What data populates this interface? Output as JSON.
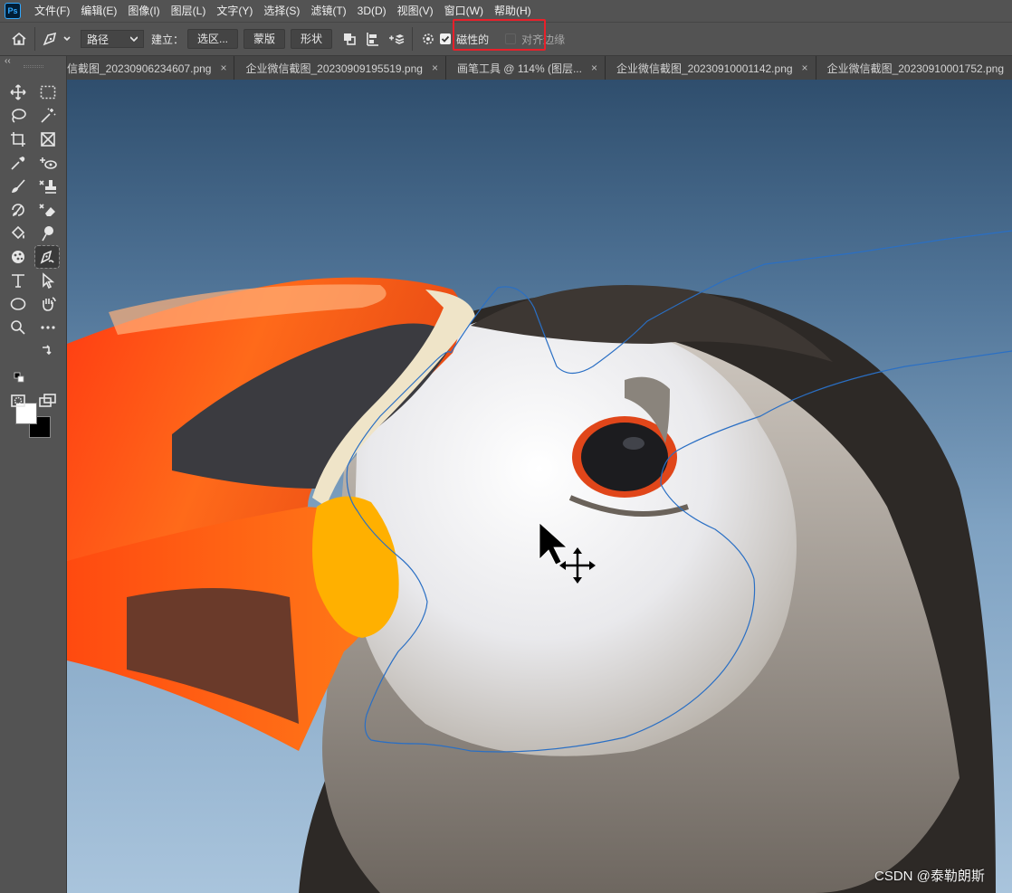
{
  "menubar": {
    "app_logo": "Ps",
    "items": [
      "文件(F)",
      "编辑(E)",
      "图像(I)",
      "图层(L)",
      "文字(Y)",
      "选择(S)",
      "滤镜(T)",
      "3D(D)",
      "视图(V)",
      "窗口(W)",
      "帮助(H)"
    ]
  },
  "options": {
    "mode_value": "路径",
    "make_label": "建立：",
    "selection_button": "选区...",
    "mask_button": "蒙版",
    "shape_button": "形状",
    "magnetic_label": "磁性的",
    "magnetic_checked": true,
    "align_edges_label": "对齐边缘",
    "align_edges_checked": false,
    "highlight_color": "#e8202a"
  },
  "tabs": [
    {
      "label": "信截图_20230906234607.png",
      "close": "×"
    },
    {
      "label": "企业微信截图_20230909195519.png",
      "close": "×"
    },
    {
      "label": "画笔工具 @ 114% (图层...",
      "close": "×"
    },
    {
      "label": "企业微信截图_20230910001142.png",
      "close": "×"
    },
    {
      "label": "企业微信截图_20230910001752.png",
      "close": "×"
    }
  ],
  "toolbar": {
    "collapse_glyph": "‹‹",
    "foreground_color": "#ffffff",
    "background_color": "#000000"
  },
  "path_color": "#2a6fc4",
  "watermark": "CSDN @泰勒朗斯"
}
